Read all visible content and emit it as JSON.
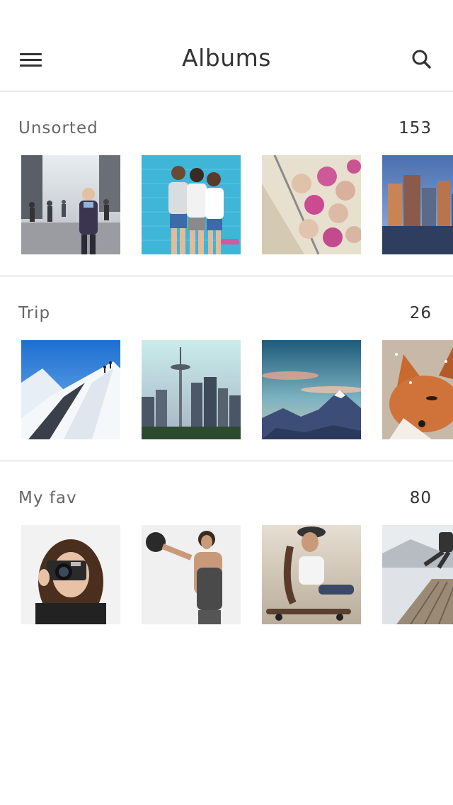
{
  "header": {
    "title": "Albums",
    "menu_icon": "hamburger-menu-icon",
    "search_icon": "search-icon"
  },
  "albums": [
    {
      "name": "Unsorted",
      "count": "153",
      "photos": [
        "city-street-crowd-photo",
        "three-girls-selfie-photo",
        "dried-roses-photo",
        "city-skyline-sunset-photo"
      ]
    },
    {
      "name": "Trip",
      "count": "26",
      "photos": [
        "snowy-mountain-climbers-photo",
        "seattle-space-needle-photo",
        "mountain-range-sky-photo",
        "snowy-fox-photo"
      ]
    },
    {
      "name": "My fav",
      "count": "80",
      "photos": [
        "woman-with-camera-photo",
        "woman-kettlebell-workout-photo",
        "woman-skateboard-photo",
        "man-jumping-pier-photo"
      ]
    }
  ],
  "colors": {
    "divider": "#c8c8c8",
    "text_primary": "#333333",
    "text_secondary": "#666666"
  }
}
